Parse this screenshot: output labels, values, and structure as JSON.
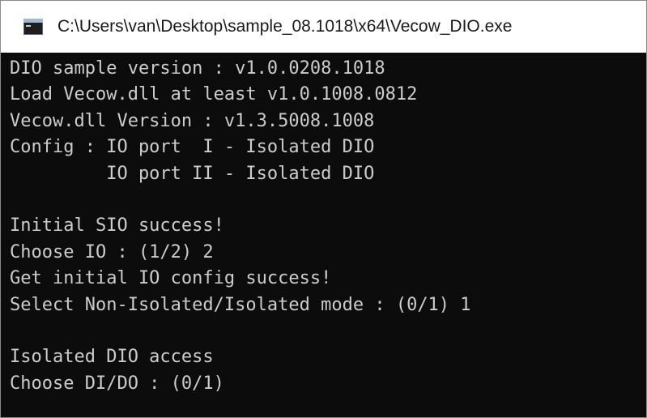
{
  "window": {
    "title": "C:\\Users\\van\\Desktop\\sample_08.1018\\x64\\Vecow_DIO.exe",
    "icon": "console-app-icon"
  },
  "console": {
    "background": "#0c0c0c",
    "foreground": "#cccccc",
    "lines": [
      "DIO sample version : v1.0.0208.1018",
      "Load Vecow.dll at least v1.0.1008.0812",
      "Vecow.dll Version : v1.3.5008.1008",
      "Config : IO port  I - Isolated DIO",
      "         IO port II - Isolated DIO",
      "",
      "Initial SIO success!",
      "Choose IO : (1/2) 2",
      "Get initial IO config success!",
      "Select Non-Isolated/Isolated mode : (0/1) 1",
      "",
      "Isolated DIO access",
      "Choose DI/DO : (0/1)"
    ]
  }
}
